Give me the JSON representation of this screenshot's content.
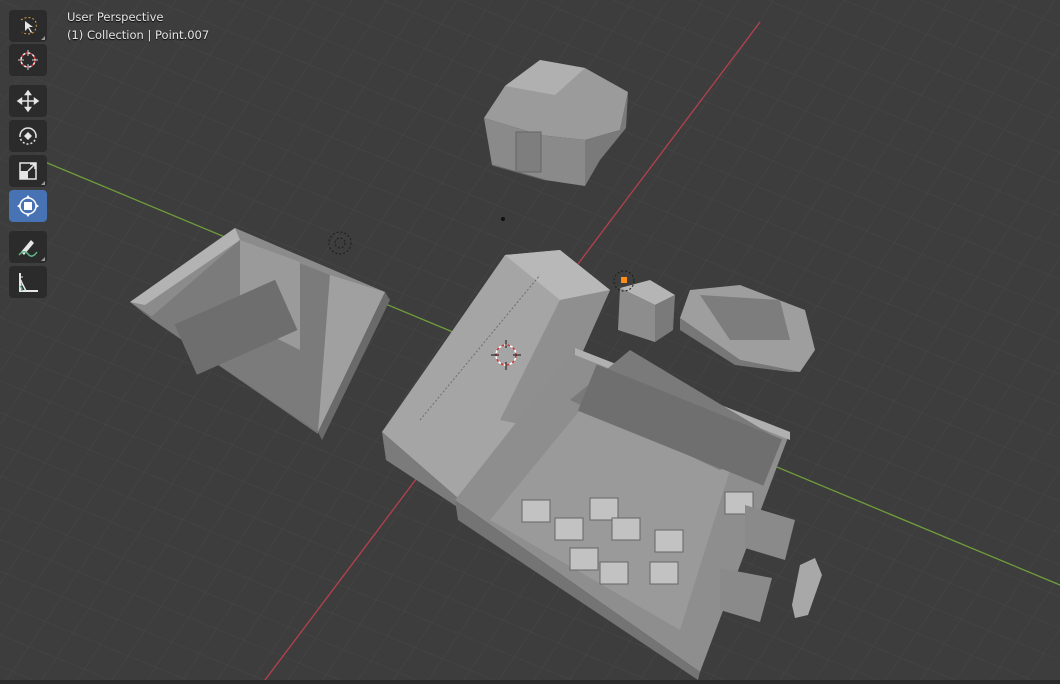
{
  "viewport": {
    "perspective_label": "User Perspective",
    "object_label": "(1) Collection | Point.007"
  },
  "colors": {
    "grid_bg": "#3d3d3d",
    "x_axis": "#b5414f",
    "y_axis": "#6f9e3a",
    "model": "#a8a8a8",
    "active_tool": "#4772b3",
    "toolbar_bg": "#2b2b2b"
  },
  "toolbar": [
    {
      "name": "select-box-tool",
      "icon": "select-box-icon",
      "active": false
    },
    {
      "name": "cursor-tool",
      "icon": "cursor-icon",
      "active": false
    },
    {
      "name": "move-tool",
      "icon": "move-icon",
      "active": false
    },
    {
      "name": "rotate-tool",
      "icon": "rotate-icon",
      "active": false
    },
    {
      "name": "scale-tool",
      "icon": "scale-icon",
      "active": false
    },
    {
      "name": "transform-tool",
      "icon": "transform-icon",
      "active": true
    },
    {
      "name": "annotate-tool",
      "icon": "annotate-icon",
      "active": false
    },
    {
      "name": "measure-tool",
      "icon": "measure-icon",
      "active": false
    }
  ]
}
